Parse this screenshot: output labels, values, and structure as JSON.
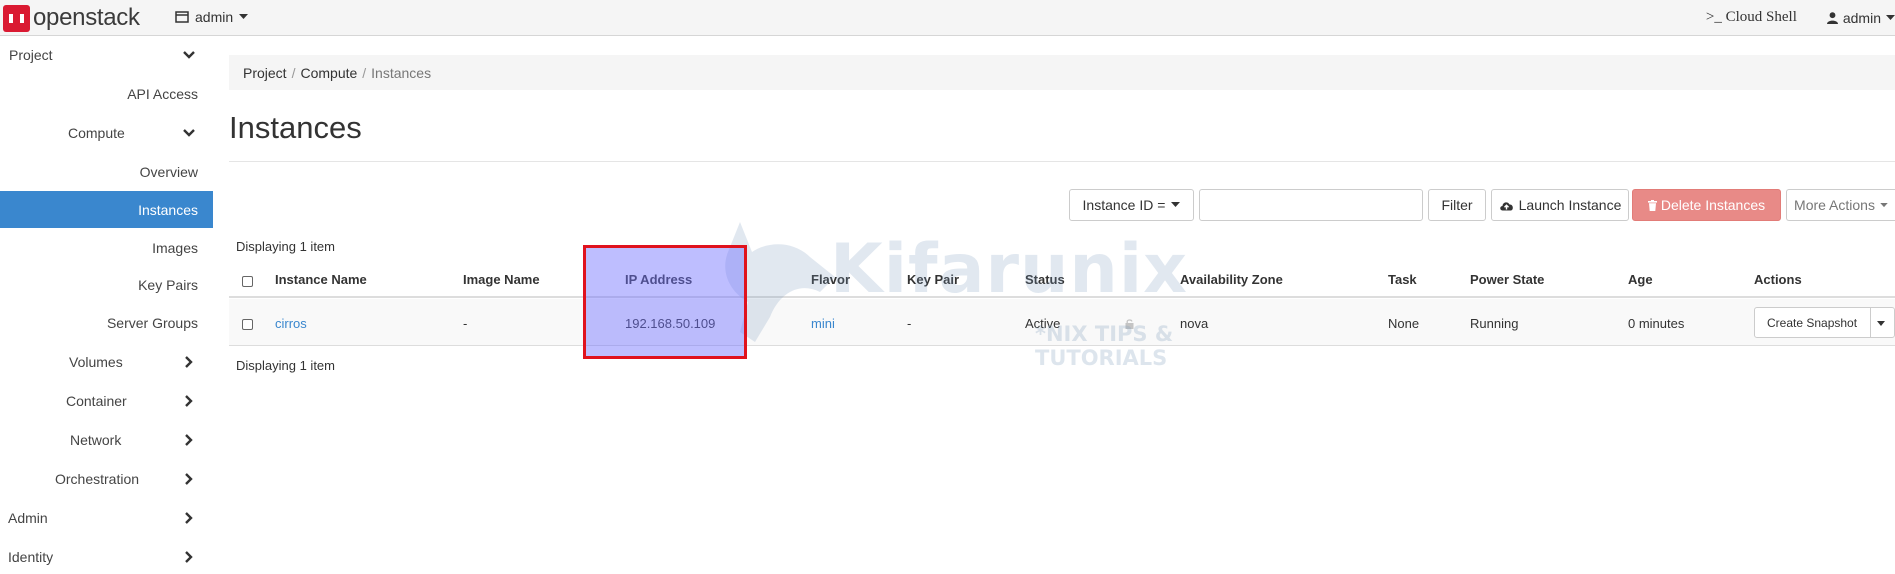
{
  "navbar": {
    "brand": "openstack",
    "project": "admin",
    "cloud_shell": ">_ Cloud Shell",
    "user": "admin"
  },
  "sidebar": {
    "project": "Project",
    "api_access": "API Access",
    "compute": "Compute",
    "overview": "Overview",
    "instances": "Instances",
    "images": "Images",
    "key_pairs": "Key Pairs",
    "server_groups": "Server Groups",
    "volumes": "Volumes",
    "container": "Container",
    "network": "Network",
    "orchestration": "Orchestration",
    "admin": "Admin",
    "identity": "Identity"
  },
  "breadcrumb": {
    "project": "Project",
    "compute": "Compute",
    "current": "Instances"
  },
  "page_title": "Instances",
  "toolbar": {
    "filter_field": "Instance ID =",
    "filter_value": "",
    "filter_button": "Filter",
    "launch_button": "Launch Instance",
    "delete_button": "Delete Instances",
    "more_actions": "More Actions"
  },
  "table": {
    "count_top": "Displaying 1 item",
    "count_bottom": "Displaying 1 item",
    "columns": [
      "Instance Name",
      "Image Name",
      "IP Address",
      "Flavor",
      "Key Pair",
      "Status",
      "Availability Zone",
      "Task",
      "Power State",
      "Age",
      "Actions"
    ],
    "rows": [
      {
        "instance_name": "cirros",
        "image_name": "-",
        "ip_address": "192.168.50.109",
        "flavor": "mini",
        "key_pair": "-",
        "status": "Active",
        "availability_zone": "nova",
        "task": "None",
        "power_state": "Running",
        "age": "0 minutes",
        "action": "Create Snapshot"
      }
    ]
  },
  "watermark": {
    "text": "Kifarunix",
    "subtitle": "*NIX TIPS & TUTORIALS"
  },
  "colors": {
    "active_nav": "#3a87ce",
    "brand_red": "#da1a32",
    "danger": "#e88a87",
    "highlight_border": "#e0121e",
    "link": "#3a87ce"
  }
}
